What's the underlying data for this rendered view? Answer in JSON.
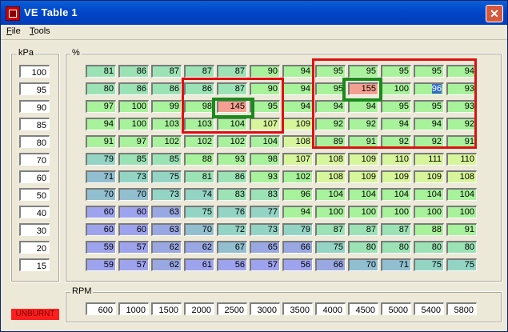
{
  "window": {
    "title": "VE Table 1",
    "close_glyph": "✕"
  },
  "menu": [
    {
      "prefix": "",
      "mnemonic": "F",
      "rest": "ile"
    },
    {
      "prefix": "",
      "mnemonic": "T",
      "rest": "ools"
    }
  ],
  "kpa_label": "kPa",
  "pct_label": "%",
  "rpm_label": "RPM",
  "kpa_values": [
    "100",
    "95",
    "90",
    "85",
    "80",
    "70",
    "60",
    "50",
    "40",
    "30",
    "20",
    "15"
  ],
  "rpm_values": [
    "600",
    "1000",
    "1500",
    "2000",
    "2500",
    "3000",
    "3500",
    "4000",
    "4500",
    "5000",
    "5400",
    "5800"
  ],
  "ve_table": [
    [
      81,
      86,
      87,
      87,
      87,
      90,
      94,
      95,
      95,
      95,
      95,
      94
    ],
    [
      80,
      86,
      86,
      86,
      87,
      90,
      94,
      95,
      155,
      100,
      96,
      93
    ],
    [
      97,
      100,
      99,
      98,
      145,
      95,
      94,
      94,
      94,
      95,
      95,
      93
    ],
    [
      94,
      100,
      103,
      103,
      104,
      107,
      109,
      92,
      92,
      94,
      94,
      92
    ],
    [
      91,
      97,
      102,
      102,
      102,
      104,
      108,
      89,
      91,
      92,
      92,
      91
    ],
    [
      79,
      85,
      85,
      88,
      93,
      98,
      107,
      108,
      109,
      110,
      111,
      110
    ],
    [
      71,
      73,
      75,
      81,
      86,
      93,
      102,
      108,
      109,
      109,
      109,
      108
    ],
    [
      70,
      70,
      73,
      74,
      83,
      83,
      96,
      104,
      104,
      104,
      104,
      104
    ],
    [
      60,
      60,
      63,
      75,
      76,
      77,
      94,
      100,
      100,
      100,
      100,
      100
    ],
    [
      60,
      60,
      63,
      70,
      72,
      73,
      79,
      87,
      87,
      87,
      88,
      91
    ],
    [
      59,
      57,
      62,
      62,
      67,
      65,
      66,
      75,
      80,
      80,
      80,
      80
    ],
    [
      59,
      57,
      62,
      61,
      56,
      57,
      56,
      66,
      70,
      71,
      75,
      75
    ]
  ],
  "selected_cell": {
    "row": 1,
    "col": 10
  },
  "status": {
    "unburnt": "UNBURNT"
  },
  "colors": {
    "accent_red": "#e01010",
    "accent_green": "#1a8a1a",
    "selection": "#316ac5"
  }
}
